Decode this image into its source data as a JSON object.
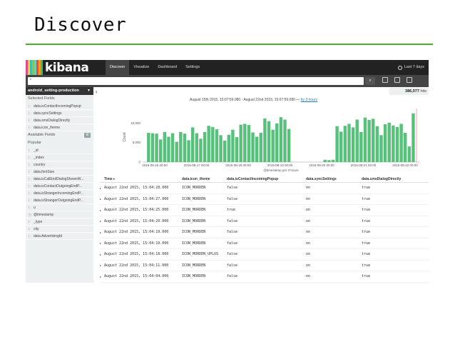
{
  "slide": {
    "title": "Discover"
  },
  "navbar": {
    "logo_text": "kibana",
    "logo_colors": [
      "#e8488b",
      "#f3d22b",
      "#3ebeb0",
      "#8cc63f",
      "#6dccb1",
      "#e54b4b",
      "#f99b1c",
      "#3cb878"
    ],
    "tabs": [
      {
        "label": "Discover",
        "active": true
      },
      {
        "label": "Visualize",
        "active": false
      },
      {
        "label": "Dashboard",
        "active": false
      },
      {
        "label": "Settings",
        "active": false
      }
    ],
    "time_label": "Last 7 days"
  },
  "search": {
    "value": "*",
    "button_icon": "search-icon",
    "tools": [
      "new-icon",
      "save-icon",
      "open-icon"
    ]
  },
  "sidebar": {
    "index": "android_setting-production",
    "selected_title": "Selected Fields",
    "selected": [
      {
        "type": "t",
        "label": "data.isContactIncomingPopup"
      },
      {
        "type": "t",
        "label": "data.syncSettings"
      },
      {
        "type": "t",
        "label": "data.smsDialogDirectly"
      },
      {
        "type": "t",
        "label": "data.icon_theme"
      }
    ],
    "available_title": "Available Fields",
    "popular_title": "Popular",
    "available": [
      {
        "type": "t",
        "label": "_id"
      },
      {
        "type": "t",
        "label": "_index"
      },
      {
        "type": "t",
        "label": "country"
      },
      {
        "type": "t",
        "label": "data.fontSize"
      },
      {
        "type": "t",
        "label": "data.isCallEndDialogShownW..."
      },
      {
        "type": "t",
        "label": "data.isContactOutgoingEndP..."
      },
      {
        "type": "t",
        "label": "data.isStrangerIncomingEndP..."
      },
      {
        "type": "t",
        "label": "data.isStrangerOutgoingEndP..."
      },
      {
        "type": "t",
        "label": "u"
      },
      {
        "type": "◷",
        "label": "@timestamp"
      },
      {
        "type": "t",
        "label": "_type"
      },
      {
        "type": "t",
        "label": "city"
      },
      {
        "type": "t",
        "label": "data.AdvertisingId"
      }
    ]
  },
  "hits": {
    "count": "386,077",
    "label": "hits"
  },
  "range": {
    "text": "August 15th 2015, 15:07:59.080 - August 22nd 2015, 15:07:59.080 —",
    "link": "by 3 hours"
  },
  "chart_data": {
    "type": "bar",
    "ylabel": "Count",
    "xlabel": "@timestamp per 3 hours",
    "y_ticks": [
      "10,000",
      "5,000",
      "0"
    ],
    "ylim": [
      0,
      13000
    ],
    "x_tick_labels": [
      "2015-08-16 00:00",
      "2015-08-17 00:00",
      "2015-08-18 00:00",
      "2015-08-19 00:00",
      "2015-08-20 00:00",
      "2015-08-21 00:00",
      "2015-08-22 00:00"
    ],
    "color": "#57c17b",
    "values": [
      0,
      7500,
      7400,
      7300,
      5800,
      7700,
      6500,
      7400,
      5200,
      7700,
      7300,
      5600,
      8900,
      7400,
      6000,
      7700,
      9300,
      9000,
      8400,
      6900,
      5500,
      7000,
      8300,
      6400,
      9600,
      9800,
      9500,
      7600,
      6500,
      7500,
      11200,
      10500,
      8300,
      9900,
      11500,
      10900,
      8500,
      0,
      0,
      0,
      0,
      0,
      0,
      0,
      0,
      600,
      500,
      600,
      9200,
      7800,
      9300,
      9800,
      8900,
      10900,
      7700,
      11400,
      10800,
      11100,
      9200,
      6900,
      9700,
      10100,
      9400,
      9000,
      9800,
      7500,
      4000,
      12500,
      0
    ]
  },
  "table": {
    "headers": [
      "Time",
      "data.icon_theme",
      "data.isContactIncomingPopup",
      "data.syncSettings",
      "data.smsDialogDirectly"
    ],
    "rows": [
      [
        "August 22nd 2015, 15:04:28.000",
        "ICON_MORDEN",
        "false",
        "on",
        "true"
      ],
      [
        "August 22nd 2015, 15:04:27.000",
        "ICON_MORDEN",
        "false",
        "on",
        "true"
      ],
      [
        "August 22nd 2015, 15:04:25.000",
        "ICON_MORDEN",
        "true",
        "on",
        "true"
      ],
      [
        "August 22nd 2015, 15:04:20.000",
        "ICON_MORDEN",
        "false",
        "on",
        "true"
      ],
      [
        "August 22nd 2015, 15:04:19.000",
        "ICON_MORDEN",
        "false",
        "on",
        "true"
      ],
      [
        "August 22nd 2015, 15:04:19.000",
        "ICON_MORDEN",
        "false",
        "on",
        "true"
      ],
      [
        "August 22nd 2015, 15:04:18.000",
        "ICON_MORDEN_UPLUS",
        "false",
        "on",
        "true"
      ],
      [
        "August 22nd 2015, 15:04:11.000",
        "ICON_MORDEN",
        "false",
        "on",
        "true"
      ],
      [
        "August 22nd 2015, 15:04:04.000",
        "ICON_MORDEN",
        "false",
        "on",
        "true"
      ]
    ]
  }
}
